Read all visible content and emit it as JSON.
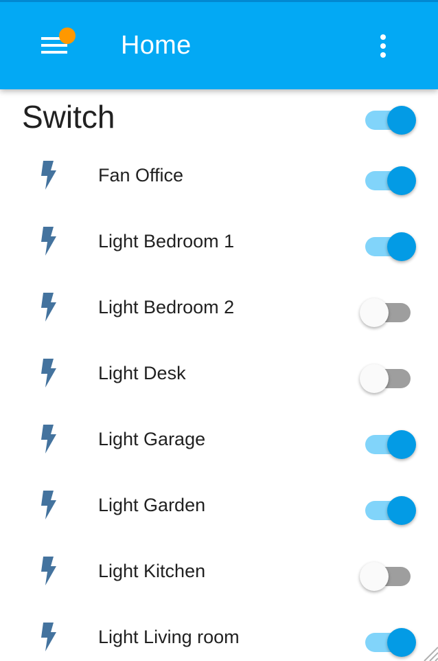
{
  "header": {
    "title": "Home",
    "menu_icon": "hamburger-menu-icon",
    "more_icon": "more-vertical-icon",
    "notification_color": "#ff9800",
    "bar_color": "#03a9f4"
  },
  "section": {
    "title": "Switch",
    "master_on": true
  },
  "switches": [
    {
      "label": "Fan Office",
      "on": true,
      "icon": "flash-icon"
    },
    {
      "label": "Light Bedroom 1",
      "on": true,
      "icon": "flash-icon"
    },
    {
      "label": "Light Bedroom 2",
      "on": false,
      "icon": "flash-icon"
    },
    {
      "label": "Light Desk",
      "on": false,
      "icon": "flash-icon"
    },
    {
      "label": "Light Garage",
      "on": true,
      "icon": "flash-icon"
    },
    {
      "label": "Light Garden",
      "on": true,
      "icon": "flash-icon"
    },
    {
      "label": "Light Kitchen",
      "on": false,
      "icon": "flash-icon"
    },
    {
      "label": "Light Living room",
      "on": true,
      "icon": "flash-icon"
    }
  ],
  "colors": {
    "accent": "#039be5",
    "accent_track": "#81d4fa",
    "off_track": "#9e9e9e",
    "icon": "#44739e"
  }
}
